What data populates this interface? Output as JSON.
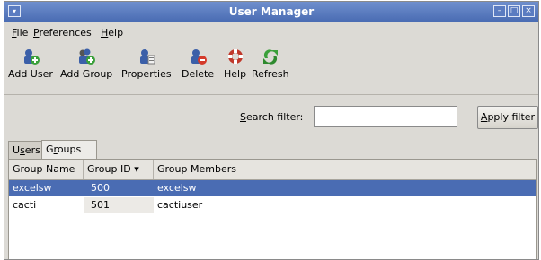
{
  "window": {
    "title": "User Manager",
    "menu_glyph": "▾",
    "minimize": "–",
    "maximize": "□",
    "close": "×"
  },
  "menu": [
    {
      "key": "file",
      "mn": "F",
      "rest": "ile"
    },
    {
      "key": "preferences",
      "mn": "P",
      "rest": "references"
    },
    {
      "key": "help",
      "mn": "H",
      "rest": "elp"
    }
  ],
  "toolbar": {
    "add_user": "Add User",
    "add_group": "Add Group",
    "properties": "Properties",
    "delete": "Delete",
    "help": "Help",
    "refresh": "Refresh"
  },
  "filter": {
    "label_mn": "S",
    "label_rest": "earch filter:",
    "value": "",
    "apply_mn": "A",
    "apply_rest": "pply filter"
  },
  "tabs": [
    {
      "mn": "s",
      "pre": "U",
      "rest": "ers"
    },
    {
      "mn": "r",
      "pre": "G",
      "rest": "oups"
    }
  ],
  "table": {
    "headers": [
      "Group Name",
      "Group ID",
      "Group Members"
    ],
    "sort_indicator": "▾",
    "rows": [
      {
        "name": "excelsw",
        "id": "500",
        "members": "excelsw",
        "selected": true
      },
      {
        "name": "cacti",
        "id": "501",
        "members": "cactiuser",
        "selected": false
      }
    ]
  },
  "colors": {
    "title_bar": "#4a6cb3",
    "selection": "#4a6cb3",
    "window_bg": "#dcdad5"
  }
}
